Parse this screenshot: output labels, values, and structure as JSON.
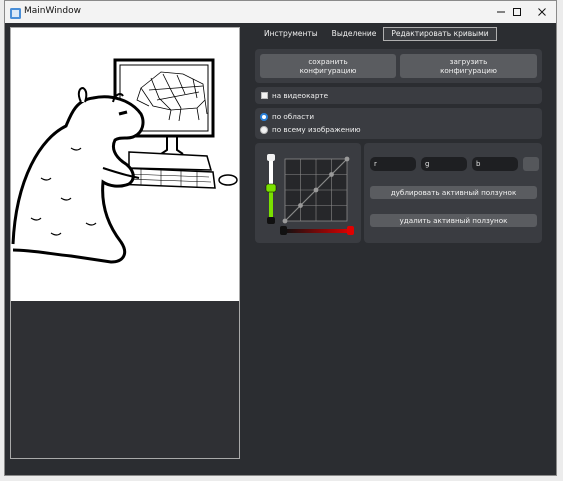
{
  "window": {
    "title": "MainWindow",
    "controls": [
      "minimize-icon",
      "maximize-icon",
      "close-icon"
    ]
  },
  "tabs": [
    {
      "label": "Инструменты",
      "active": false
    },
    {
      "label": "Выделение",
      "active": false
    },
    {
      "label": "Редактировать кривыми",
      "active": true
    }
  ],
  "config": {
    "save_label": "сохранить\nконфигурацию",
    "load_label": "загрузить\nконфигурацию"
  },
  "gpu": {
    "label": "на видеокарте",
    "checked": false
  },
  "scope": {
    "options": [
      {
        "label": "по области",
        "selected": true
      },
      {
        "label": "по всему изображению",
        "selected": false
      }
    ]
  },
  "curve_editor": {
    "curve_points": [
      [
        0,
        0
      ],
      [
        0.25,
        0.25
      ],
      [
        0.5,
        0.5
      ],
      [
        0.75,
        0.75
      ],
      [
        1,
        1
      ]
    ],
    "vertical_slider_value": 0.5,
    "horizontal_slider_value": 1.0,
    "colors": {
      "slider_green": "#7ae000",
      "slider_red": "#e00000"
    }
  },
  "rgb": {
    "r_label": "r",
    "g_label": "g",
    "b_label": "b"
  },
  "actions": {
    "duplicate_label": "дублировать активный ползунок",
    "delete_label": "удалить активный ползунок"
  },
  "colors": {
    "background": "#2b2d31",
    "group": "#3a3c41",
    "button": "#5a5c60",
    "accent": "#2a80d8"
  }
}
